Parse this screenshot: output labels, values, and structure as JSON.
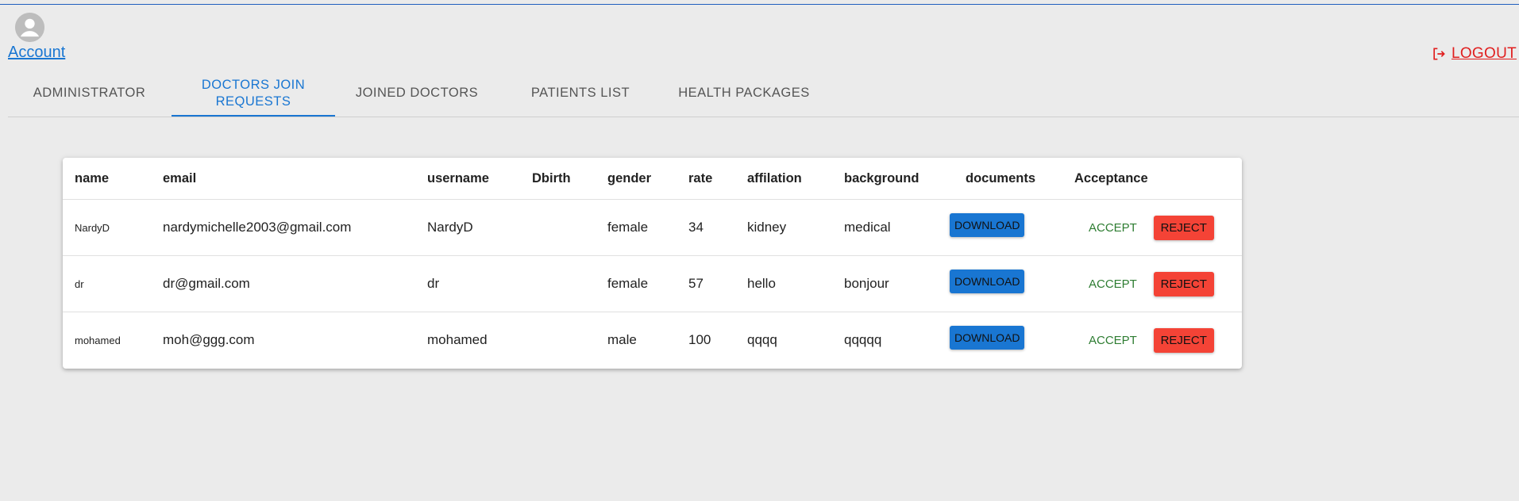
{
  "header": {
    "account_label": "Account",
    "logout_label": "LOGOUT"
  },
  "tabs": [
    {
      "label": "ADMINISTRATOR"
    },
    {
      "label": "DOCTORS JOIN REQUESTS"
    },
    {
      "label": "JOINED DOCTORS"
    },
    {
      "label": "PATIENTS LIST"
    },
    {
      "label": "HEALTH PACKAGES"
    }
  ],
  "active_tab": "DOCTORS JOIN REQUESTS",
  "table": {
    "columns": [
      "name",
      "email",
      "username",
      "Dbirth",
      "gender",
      "rate",
      "affilation",
      "background",
      "documents",
      "Acceptance"
    ],
    "rows": [
      {
        "name": "NardyD",
        "email": "nardymichelle2003@gmail.com",
        "username": "NardyD",
        "dbirth": "",
        "gender": "female",
        "rate": "34",
        "affilation": "kidney",
        "background": "medical"
      },
      {
        "name": "dr",
        "email": "dr@gmail.com",
        "username": "dr",
        "dbirth": "",
        "gender": "female",
        "rate": "57",
        "affilation": "hello",
        "background": "bonjour"
      },
      {
        "name": "mohamed",
        "email": "moh@ggg.com",
        "username": "mohamed",
        "dbirth": "",
        "gender": "male",
        "rate": "100",
        "affilation": "qqqq",
        "background": "qqqqq"
      }
    ],
    "download_label": "DOWNLOAD",
    "accept_label": "ACCEPT",
    "reject_label": "REJECT"
  },
  "colors": {
    "primary": "#1976d2",
    "accept": "#2e7d32",
    "reject": "#f44336",
    "logout": "#e01e1e",
    "background": "#ebebeb"
  },
  "icons": {
    "avatar": "account-circle-icon",
    "logout": "logout-icon"
  }
}
